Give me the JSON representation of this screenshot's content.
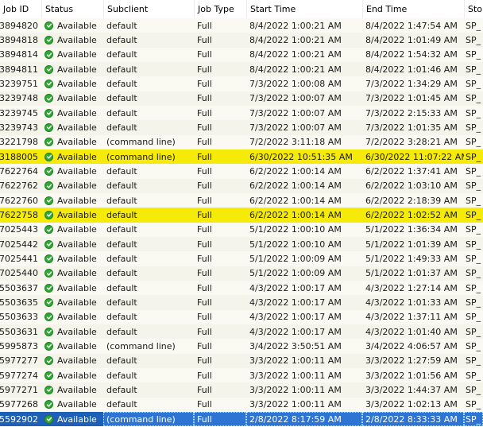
{
  "columns": {
    "job_id": "Job ID",
    "status": "Status",
    "subclient": "Subclient",
    "job_type": "Job Type",
    "start_time": "Start Time",
    "end_time": "End Time",
    "storage": "Sto"
  },
  "status_icon": "check-circle-icon",
  "colors": {
    "highlight": "#f6ea08",
    "selected": "#2f74d3",
    "status_ok": "#31a836"
  },
  "rows": [
    {
      "job_id": "3894820",
      "status": "Available",
      "subclient": "default",
      "job_type": "Full",
      "start_time": "8/4/2022 1:00:21 AM",
      "end_time": "8/4/2022 1:47:54 AM",
      "storage": "SP_",
      "state": "normal"
    },
    {
      "job_id": "3894818",
      "status": "Available",
      "subclient": "default",
      "job_type": "Full",
      "start_time": "8/4/2022 1:00:21 AM",
      "end_time": "8/4/2022 1:01:49 AM",
      "storage": "SP_",
      "state": "normal"
    },
    {
      "job_id": "3894814",
      "status": "Available",
      "subclient": "default",
      "job_type": "Full",
      "start_time": "8/4/2022 1:00:21 AM",
      "end_time": "8/4/2022 1:54:32 AM",
      "storage": "SP_",
      "state": "normal"
    },
    {
      "job_id": "3894811",
      "status": "Available",
      "subclient": "default",
      "job_type": "Full",
      "start_time": "8/4/2022 1:00:21 AM",
      "end_time": "8/4/2022 1:01:46 AM",
      "storage": "SP_",
      "state": "normal"
    },
    {
      "job_id": "3239751",
      "status": "Available",
      "subclient": "default",
      "job_type": "Full",
      "start_time": "7/3/2022 1:00:08 AM",
      "end_time": "7/3/2022 1:34:29 AM",
      "storage": "SP_",
      "state": "normal"
    },
    {
      "job_id": "3239748",
      "status": "Available",
      "subclient": "default",
      "job_type": "Full",
      "start_time": "7/3/2022 1:00:07 AM",
      "end_time": "7/3/2022 1:01:45 AM",
      "storage": "SP_",
      "state": "normal"
    },
    {
      "job_id": "3239745",
      "status": "Available",
      "subclient": "default",
      "job_type": "Full",
      "start_time": "7/3/2022 1:00:07 AM",
      "end_time": "7/3/2022 2:15:33 AM",
      "storage": "SP_",
      "state": "normal"
    },
    {
      "job_id": "3239743",
      "status": "Available",
      "subclient": "default",
      "job_type": "Full",
      "start_time": "7/3/2022 1:00:07 AM",
      "end_time": "7/3/2022 1:01:35 AM",
      "storage": "SP_",
      "state": "normal"
    },
    {
      "job_id": "3221798",
      "status": "Available",
      "subclient": "(command line)",
      "job_type": "Full",
      "start_time": "7/2/2022 3:11:18 AM",
      "end_time": "7/2/2022 3:28:21 AM",
      "storage": "SP_",
      "state": "normal"
    },
    {
      "job_id": "3188005",
      "status": "Available",
      "subclient": "(command line)",
      "job_type": "Full",
      "start_time": "6/30/2022 10:51:35 AM",
      "end_time": "6/30/2022 11:07:22 AM",
      "storage": "SP_",
      "state": "highlight"
    },
    {
      "job_id": "7622764",
      "status": "Available",
      "subclient": "default",
      "job_type": "Full",
      "start_time": "6/2/2022 1:00:14 AM",
      "end_time": "6/2/2022 1:37:41 AM",
      "storage": "SP_",
      "state": "normal"
    },
    {
      "job_id": "7622762",
      "status": "Available",
      "subclient": "default",
      "job_type": "Full",
      "start_time": "6/2/2022 1:00:14 AM",
      "end_time": "6/2/2022 1:03:10 AM",
      "storage": "SP_",
      "state": "normal"
    },
    {
      "job_id": "7622760",
      "status": "Available",
      "subclient": "default",
      "job_type": "Full",
      "start_time": "6/2/2022 1:00:14 AM",
      "end_time": "6/2/2022 2:18:39 AM",
      "storage": "SP_",
      "state": "normal"
    },
    {
      "job_id": "7622758",
      "status": "Available",
      "subclient": "default",
      "job_type": "Full",
      "start_time": "6/2/2022 1:00:14 AM",
      "end_time": "6/2/2022 1:02:52 AM",
      "storage": "SP_",
      "state": "highlight"
    },
    {
      "job_id": "7025443",
      "status": "Available",
      "subclient": "default",
      "job_type": "Full",
      "start_time": "5/1/2022 1:00:10 AM",
      "end_time": "5/1/2022 1:36:34 AM",
      "storage": "SP_",
      "state": "normal"
    },
    {
      "job_id": "7025442",
      "status": "Available",
      "subclient": "default",
      "job_type": "Full",
      "start_time": "5/1/2022 1:00:10 AM",
      "end_time": "5/1/2022 1:01:39 AM",
      "storage": "SP_",
      "state": "normal"
    },
    {
      "job_id": "7025441",
      "status": "Available",
      "subclient": "default",
      "job_type": "Full",
      "start_time": "5/1/2022 1:00:09 AM",
      "end_time": "5/1/2022 1:49:33 AM",
      "storage": "SP_",
      "state": "normal"
    },
    {
      "job_id": "7025440",
      "status": "Available",
      "subclient": "default",
      "job_type": "Full",
      "start_time": "5/1/2022 1:00:09 AM",
      "end_time": "5/1/2022 1:01:37 AM",
      "storage": "SP_",
      "state": "normal"
    },
    {
      "job_id": "5503637",
      "status": "Available",
      "subclient": "default",
      "job_type": "Full",
      "start_time": "4/3/2022 1:00:17 AM",
      "end_time": "4/3/2022 1:27:14 AM",
      "storage": "SP_",
      "state": "normal"
    },
    {
      "job_id": "5503635",
      "status": "Available",
      "subclient": "default",
      "job_type": "Full",
      "start_time": "4/3/2022 1:00:17 AM",
      "end_time": "4/3/2022 1:01:33 AM",
      "storage": "SP_",
      "state": "normal"
    },
    {
      "job_id": "5503633",
      "status": "Available",
      "subclient": "default",
      "job_type": "Full",
      "start_time": "4/3/2022 1:00:17 AM",
      "end_time": "4/3/2022 1:37:11 AM",
      "storage": "SP_",
      "state": "normal"
    },
    {
      "job_id": "5503631",
      "status": "Available",
      "subclient": "default",
      "job_type": "Full",
      "start_time": "4/3/2022 1:00:17 AM",
      "end_time": "4/3/2022 1:01:40 AM",
      "storage": "SP_",
      "state": "normal"
    },
    {
      "job_id": "5995873",
      "status": "Available",
      "subclient": "(command line)",
      "job_type": "Full",
      "start_time": "3/4/2022 3:50:51 AM",
      "end_time": "3/4/2022 4:06:57 AM",
      "storage": "SP_",
      "state": "normal"
    },
    {
      "job_id": "5977277",
      "status": "Available",
      "subclient": "default",
      "job_type": "Full",
      "start_time": "3/3/2022 1:00:11 AM",
      "end_time": "3/3/2022 1:27:59 AM",
      "storage": "SP_",
      "state": "normal"
    },
    {
      "job_id": "5977274",
      "status": "Available",
      "subclient": "default",
      "job_type": "Full",
      "start_time": "3/3/2022 1:00:11 AM",
      "end_time": "3/3/2022 1:01:56 AM",
      "storage": "SP_",
      "state": "normal"
    },
    {
      "job_id": "5977271",
      "status": "Available",
      "subclient": "default",
      "job_type": "Full",
      "start_time": "3/3/2022 1:00:11 AM",
      "end_time": "3/3/2022 1:44:37 AM",
      "storage": "SP_",
      "state": "normal"
    },
    {
      "job_id": "5977268",
      "status": "Available",
      "subclient": "default",
      "job_type": "Full",
      "start_time": "3/3/2022 1:00:11 AM",
      "end_time": "3/3/2022 1:02:13 AM",
      "storage": "SP_",
      "state": "normal"
    },
    {
      "job_id": "5592902",
      "status": "Available",
      "subclient": "(command line)",
      "job_type": "Full",
      "start_time": "2/8/2022 8:17:59 AM",
      "end_time": "2/8/2022 8:33:33 AM",
      "storage": "SP_",
      "state": "selected"
    }
  ]
}
